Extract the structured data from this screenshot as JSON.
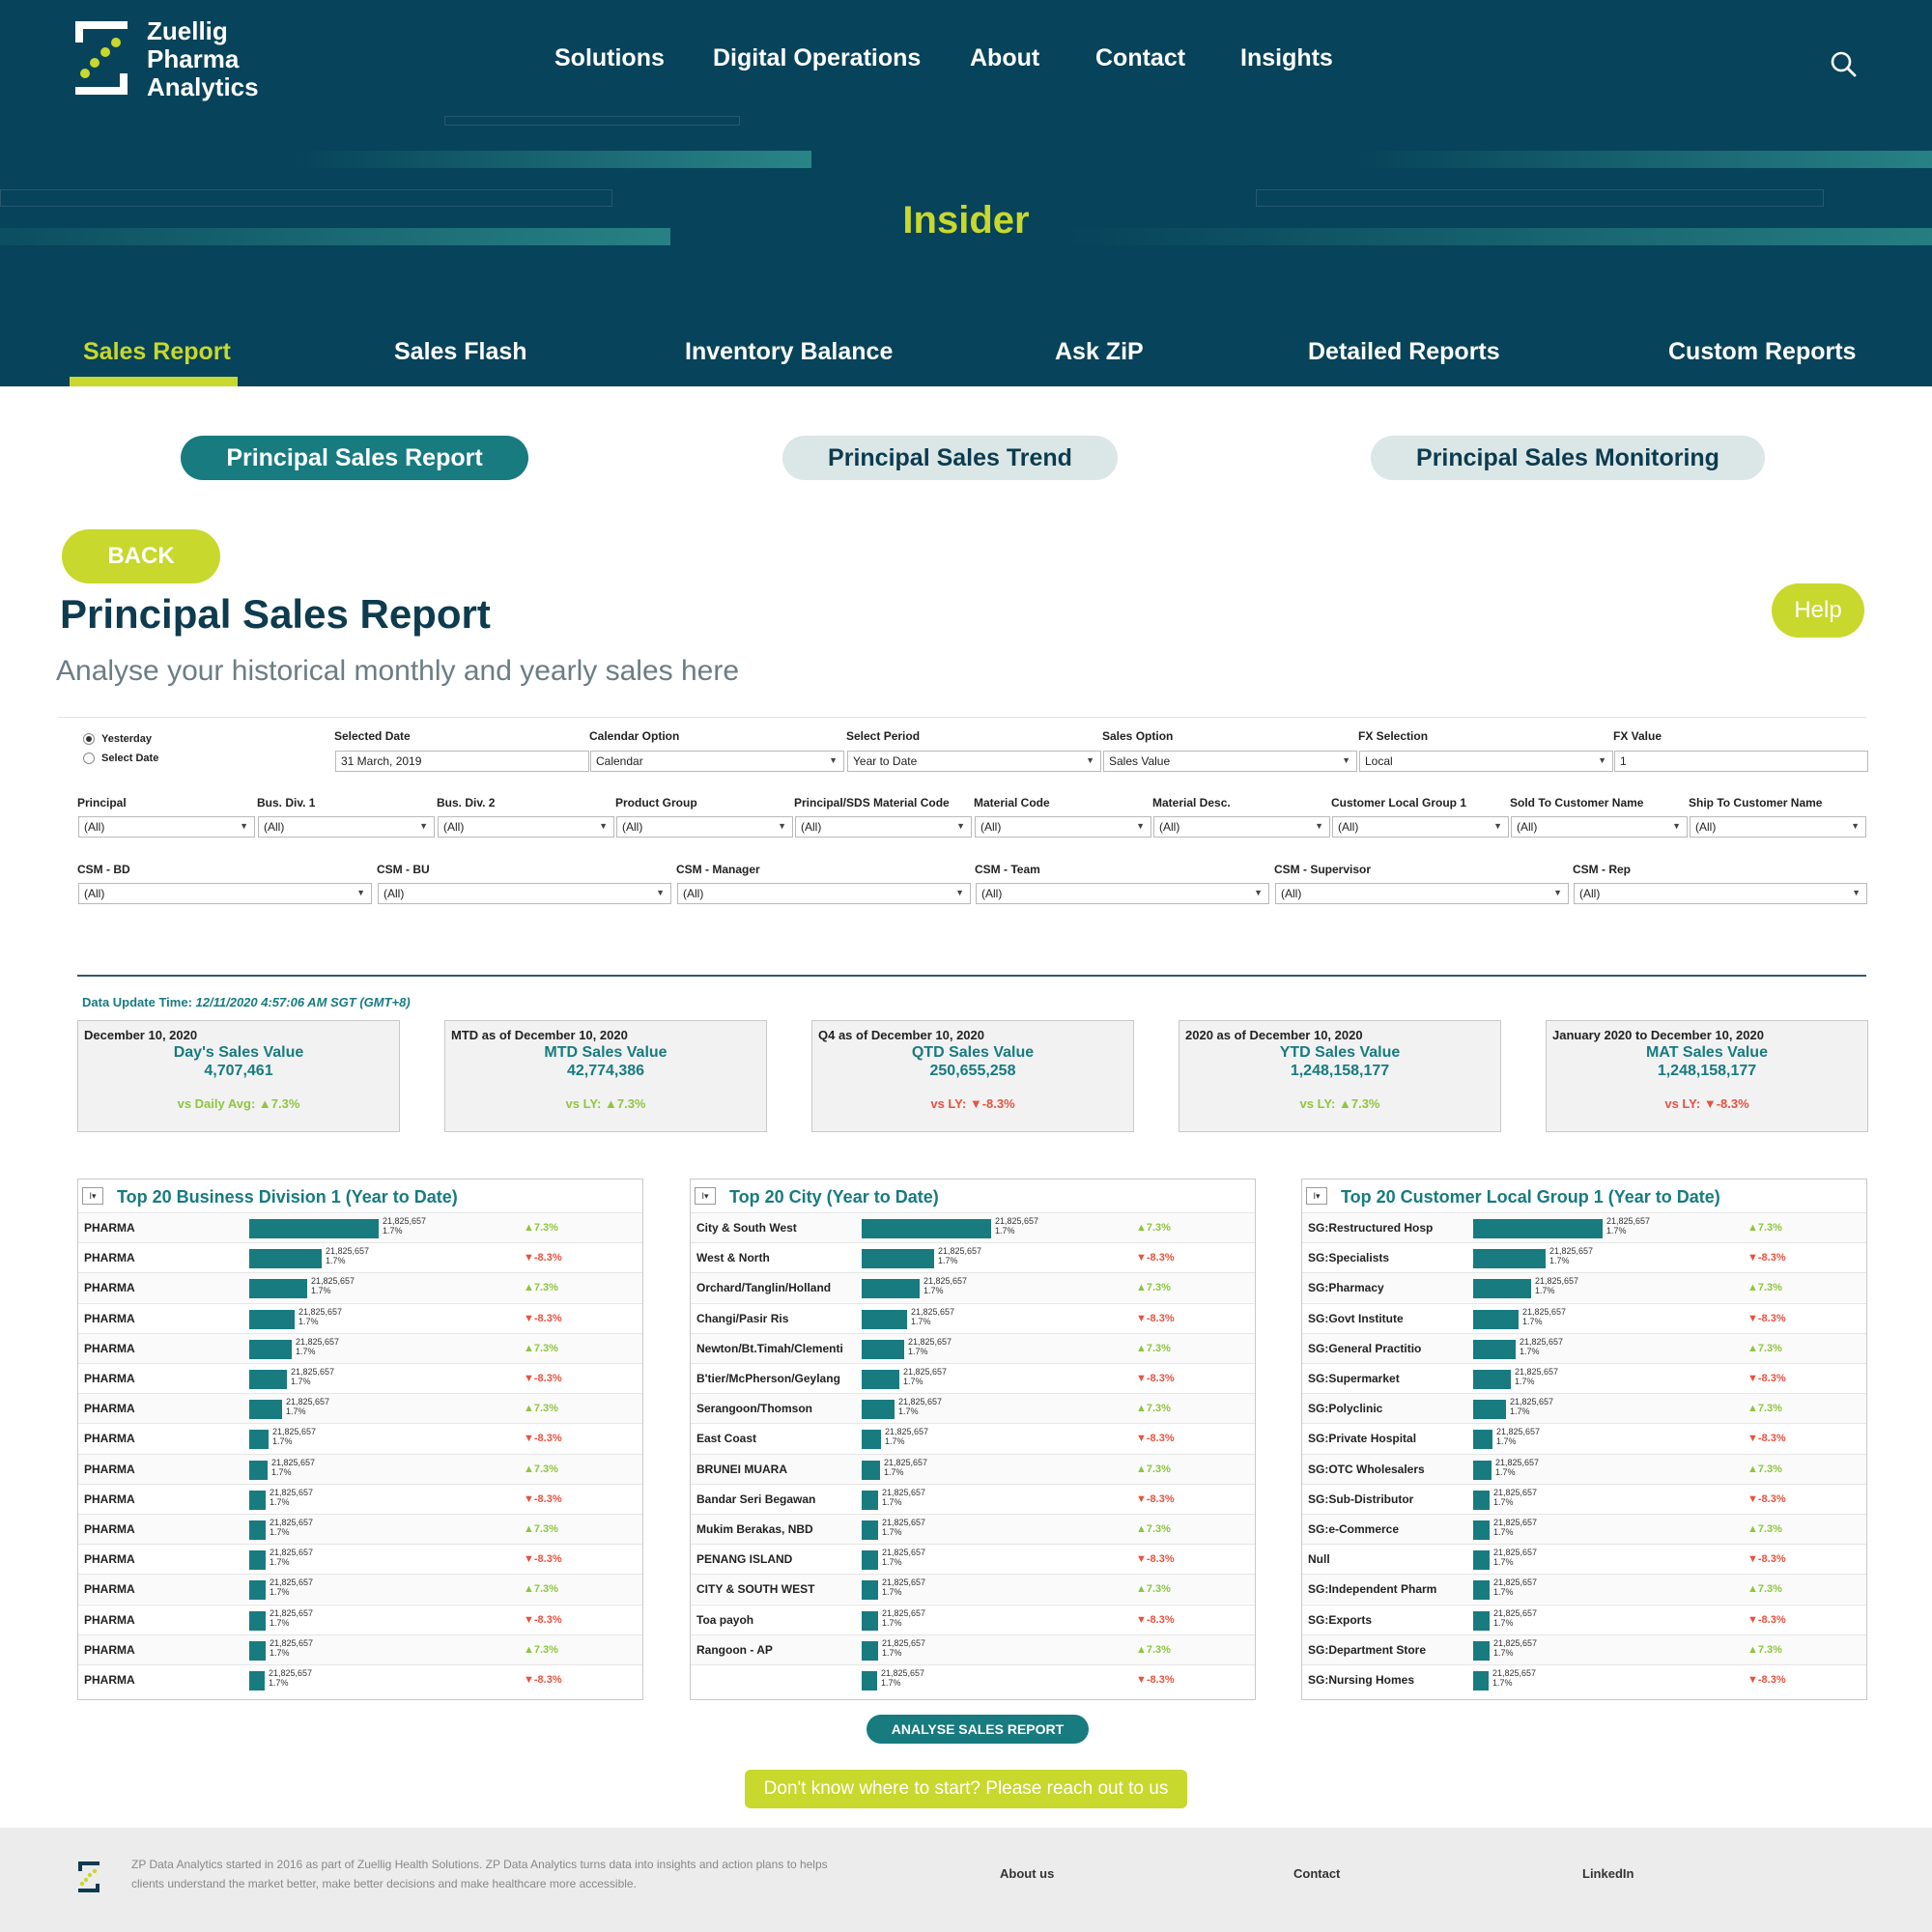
{
  "brand": {
    "line1": "Zuellig",
    "line2": "Pharma",
    "line3": "Analytics",
    "accent": "#c8d82c",
    "primary": "#07435a",
    "teal": "#177b80"
  },
  "nav": [
    "Solutions",
    "Digital Operations",
    "About",
    "Contact",
    "Insights"
  ],
  "icons": {
    "search": "search-icon",
    "logo": "zuellig-logo-icon"
  },
  "hero_title": "Insider",
  "tabs": [
    "Sales Report",
    "Sales Flash",
    "Inventory Balance",
    "Ask ZiP",
    "Detailed Reports",
    "Custom Reports"
  ],
  "active_tab": "Sales Report",
  "subtabs": [
    "Principal Sales Report",
    "Principal Sales Trend",
    "Principal Sales Monitoring"
  ],
  "back_label": "BACK",
  "help_label": "Help",
  "title": "Principal Sales Report",
  "subtitle": "Analyse your historical monthly and yearly sales here",
  "filters": {
    "date_mode": {
      "yesterday": "Yesterday",
      "select_date": "Select Date",
      "selected": "Yesterday"
    },
    "row1": [
      {
        "label": "Selected Date",
        "value": "31 March, 2019",
        "dropdown": false
      },
      {
        "label": "Calendar Option",
        "value": "Calendar",
        "dropdown": true
      },
      {
        "label": "Select Period",
        "value": "Year to Date",
        "dropdown": true
      },
      {
        "label": "Sales Option",
        "value": "Sales Value",
        "dropdown": true
      },
      {
        "label": "FX Selection",
        "value": "Local",
        "dropdown": true
      },
      {
        "label": "FX Value",
        "value": "1",
        "dropdown": false
      }
    ],
    "row2": [
      {
        "label": "Principal",
        "value": "(All)"
      },
      {
        "label": "Bus. Div. 1",
        "value": "(All)"
      },
      {
        "label": "Bus. Div. 2",
        "value": "(All)"
      },
      {
        "label": "Product Group",
        "value": "(All)"
      },
      {
        "label": "Principal/SDS Material Code",
        "value": "(All)"
      },
      {
        "label": "Material Code",
        "value": "(All)"
      },
      {
        "label": "Material Desc.",
        "value": "(All)"
      },
      {
        "label": "Customer Local Group 1",
        "value": "(All)"
      },
      {
        "label": "Sold To Customer Name",
        "value": "(All)"
      },
      {
        "label": "Ship To Customer Name",
        "value": "(All)"
      }
    ],
    "row3": [
      {
        "label": "CSM - BD",
        "value": "(All)"
      },
      {
        "label": "CSM - BU",
        "value": "(All)"
      },
      {
        "label": "CSM - Manager",
        "value": "(All)"
      },
      {
        "label": "CSM - Team",
        "value": "(All)"
      },
      {
        "label": "CSM - Supervisor",
        "value": "(All)"
      },
      {
        "label": "CSM - Rep",
        "value": "(All)"
      }
    ]
  },
  "update_label": "Data Update Time:",
  "update_time": "12/11/2020 4:57:06 AM SGT (GMT+8)",
  "kpis": [
    {
      "date": "December 10, 2020",
      "title": "Day's Sales Value",
      "value": "4,707,461",
      "cmp_label": "vs Daily Avg:",
      "cmp": "▲7.3%",
      "dir": "up"
    },
    {
      "date": "MTD as of December 10, 2020",
      "title": "MTD Sales Value",
      "value": "42,774,386",
      "cmp_label": "vs LY:",
      "cmp": "▲7.3%",
      "dir": "up"
    },
    {
      "date": "Q4 as of December 10, 2020",
      "title": "QTD Sales Value",
      "value": "250,655,258",
      "cmp_label": "vs LY:",
      "cmp": "▼-8.3%",
      "dir": "down"
    },
    {
      "date": "2020 as of December 10, 2020",
      "title": "YTD Sales Value",
      "value": "1,248,158,177",
      "cmp_label": "vs LY:",
      "cmp": "▲7.3%",
      "dir": "up"
    },
    {
      "date": "January 2020 to December 10, 2020",
      "title": "MAT Sales Value",
      "value": "1,248,158,177",
      "cmp_label": "vs LY:",
      "cmp": "▼-8.3%",
      "dir": "down"
    }
  ],
  "bar_label": {
    "value": "21,825,657",
    "pct": "1.7%"
  },
  "bar_levels": [
    1.0,
    0.56,
    0.45,
    0.35,
    0.33,
    0.29,
    0.25,
    0.15,
    0.14,
    0.13,
    0.13,
    0.13,
    0.13,
    0.13,
    0.13,
    0.12,
    0.12
  ],
  "panels": [
    {
      "title": "Top 20 Business Division 1 (Year to Date)",
      "rows": [
        "PHARMA",
        "PHARMA",
        "PHARMA",
        "PHARMA",
        "PHARMA",
        "PHARMA",
        "PHARMA",
        "PHARMA",
        "PHARMA",
        "PHARMA",
        "PHARMA",
        "PHARMA",
        "PHARMA",
        "PHARMA",
        "PHARMA",
        "PHARMA"
      ]
    },
    {
      "title": "Top 20 City (Year to Date)",
      "rows": [
        "City & South West",
        "West & North",
        "Orchard/Tanglin/Holland",
        "Changi/Pasir Ris",
        "Newton/Bt.Timah/Clementi",
        "B'tier/McPherson/Geylang",
        "Serangoon/Thomson",
        "East Coast",
        "BRUNEI MUARA",
        "Bandar Seri Begawan",
        "Mukim Berakas, NBD",
        "PENANG ISLAND",
        "CITY & SOUTH WEST",
        "Toa payoh",
        "Rangoon - AP",
        ""
      ]
    },
    {
      "title": "Top 20 Customer Local Group 1 (Year to Date)",
      "rows": [
        "SG:Restructured Hosp",
        "SG:Specialists",
        "SG:Pharmacy",
        "SG:Govt Institute",
        "SG:General Practitio",
        "SG:Supermarket",
        "SG:Polyclinic",
        "SG:Private Hospital",
        "SG:OTC Wholesalers",
        "SG:Sub-Distributor",
        "SG:e-Commerce",
        "Null",
        "SG:Independent Pharm",
        "SG:Exports",
        "SG:Department Store",
        "SG:Nursing Homes"
      ]
    }
  ],
  "changes": [
    "▲7.3%",
    "▼-8.3%",
    "▲7.3%",
    "▼-8.3%",
    "▲7.3%",
    "▼-8.3%",
    "▲7.3%",
    "▼-8.3%",
    "▲7.3%",
    "▼-8.3%",
    "▲7.3%",
    "▼-8.3%",
    "▲7.3%",
    "▼-8.3%",
    "▲7.3%",
    "▼-8.3%"
  ],
  "analyse_label": "ANALYSE SALES REPORT",
  "reach_label": "Don't know where to start? Please reach out to us",
  "footer": {
    "text": "ZP Data Analytics started in 2016 as part of Zuellig Health Solutions. ZP Data Analytics turns data into insights and action plans to helps clients understand the market better, make better decisions and make healthcare more accessible.",
    "links": [
      "About us",
      "Contact",
      "LinkedIn"
    ]
  }
}
